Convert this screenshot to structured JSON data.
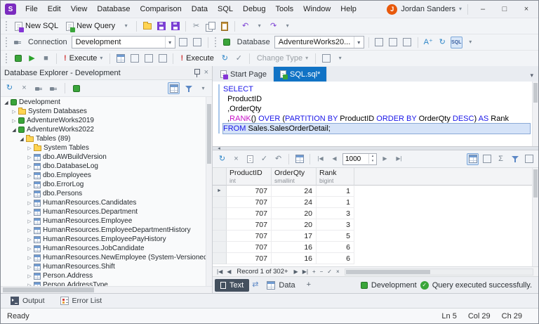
{
  "titlebar": {
    "app_initial": "S",
    "menus": [
      "File",
      "Edit",
      "View",
      "Database",
      "Comparison",
      "Data",
      "SQL",
      "Debug",
      "Tools",
      "Window",
      "Help"
    ],
    "user_initial": "J",
    "user_name": "Jordan Sanders"
  },
  "toolbars": {
    "new_sql": "New SQL",
    "new_query": "New Query",
    "connection_label": "Connection",
    "connection_value": "Development",
    "database_label": "Database",
    "database_value": "AdventureWorks20...",
    "execute_primary": "Execute",
    "execute_secondary": "Execute",
    "change_type": "Change Type"
  },
  "explorer": {
    "title": "Database Explorer - Development",
    "tree": [
      {
        "level": 0,
        "icon": "server",
        "label": "Development",
        "expanded": true
      },
      {
        "level": 1,
        "icon": "folder",
        "label": "System Databases",
        "expanded": false
      },
      {
        "level": 1,
        "icon": "database",
        "label": "AdventureWorks2019",
        "expanded": false
      },
      {
        "level": 1,
        "icon": "database",
        "label": "AdventureWorks2022",
        "expanded": true
      },
      {
        "level": 2,
        "icon": "folder",
        "label": "Tables (89)",
        "expanded": true
      },
      {
        "level": 3,
        "icon": "folder",
        "label": "System Tables",
        "expanded": false
      },
      {
        "level": 3,
        "icon": "table",
        "label": "dbo.AWBuildVersion",
        "expanded": false
      },
      {
        "level": 3,
        "icon": "table",
        "label": "dbo.DatabaseLog",
        "expanded": false
      },
      {
        "level": 3,
        "icon": "table",
        "label": "dbo.Employees",
        "expanded": false
      },
      {
        "level": 3,
        "icon": "table",
        "label": "dbo.ErrorLog",
        "expanded": false
      },
      {
        "level": 3,
        "icon": "table",
        "label": "dbo.Persons",
        "expanded": false
      },
      {
        "level": 3,
        "icon": "table",
        "label": "HumanResources.Candidates",
        "expanded": false
      },
      {
        "level": 3,
        "icon": "table",
        "label": "HumanResources.Department",
        "expanded": false
      },
      {
        "level": 3,
        "icon": "table",
        "label": "HumanResources.Employee",
        "expanded": false
      },
      {
        "level": 3,
        "icon": "table",
        "label": "HumanResources.EmployeeDepartmentHistory",
        "expanded": false
      },
      {
        "level": 3,
        "icon": "table",
        "label": "HumanResources.EmployeePayHistory",
        "expanded": false
      },
      {
        "level": 3,
        "icon": "table",
        "label": "HumanResources.JobCandidate",
        "expanded": false
      },
      {
        "level": 3,
        "icon": "table",
        "label": "HumanResources.NewEmployee (System-Versioned)",
        "expanded": false
      },
      {
        "level": 3,
        "icon": "table",
        "label": "HumanResources.Shift",
        "expanded": false
      },
      {
        "level": 3,
        "icon": "table",
        "label": "Person.Address",
        "expanded": false
      },
      {
        "level": 3,
        "icon": "table",
        "label": "Person.AddressType",
        "expanded": false
      }
    ]
  },
  "editor": {
    "tabs": [
      {
        "label": "Start Page"
      },
      {
        "label": "SQL.sql*"
      }
    ],
    "code": [
      {
        "tokens": [
          {
            "c": "kw",
            "t": "SELECT"
          }
        ]
      },
      {
        "tokens": [
          {
            "c": "pl",
            "t": "  ProductID"
          }
        ]
      },
      {
        "tokens": [
          {
            "c": "pl",
            "t": "  ,OrderQty"
          }
        ]
      },
      {
        "tokens": [
          {
            "c": "pl",
            "t": "  ,"
          },
          {
            "c": "fn",
            "t": "RANK"
          },
          {
            "c": "pl",
            "t": "() "
          },
          {
            "c": "kw",
            "t": "OVER"
          },
          {
            "c": "pl",
            "t": " ("
          },
          {
            "c": "kw",
            "t": "PARTITION BY"
          },
          {
            "c": "pl",
            "t": " ProductID "
          },
          {
            "c": "kw",
            "t": "ORDER BY"
          },
          {
            "c": "pl",
            "t": " OrderQty "
          },
          {
            "c": "kw",
            "t": "DESC"
          },
          {
            "c": "pl",
            "t": ") "
          },
          {
            "c": "kw",
            "t": "AS"
          },
          {
            "c": "pl",
            "t": " Rank"
          }
        ]
      },
      {
        "current": true,
        "tokens": [
          {
            "c": "kw",
            "t": "FROM"
          },
          {
            "c": "pl",
            "t": " Sales.SalesOrderDetail;"
          }
        ]
      }
    ]
  },
  "results": {
    "page_size": "1000",
    "columns": [
      {
        "name": "ProductID",
        "type": "int"
      },
      {
        "name": "OrderQty",
        "type": "smallint"
      },
      {
        "name": "Rank",
        "type": "bigint"
      }
    ],
    "rows": [
      [
        "707",
        "24",
        "1"
      ],
      [
        "707",
        "24",
        "1"
      ],
      [
        "707",
        "20",
        "3"
      ],
      [
        "707",
        "20",
        "3"
      ],
      [
        "707",
        "17",
        "5"
      ],
      [
        "707",
        "16",
        "6"
      ],
      [
        "707",
        "16",
        "6"
      ]
    ],
    "record_status": "Record 1 of 302+",
    "tab_text": "Text",
    "tab_data": "Data",
    "connection_name": "Development",
    "exec_status": "Query executed successfully."
  },
  "bottom_panel": {
    "tabs": [
      "Output",
      "Error List"
    ]
  },
  "statusbar": {
    "left": "Ready",
    "ln": "Ln 5",
    "col": "Col 29",
    "ch": "Ch 29"
  },
  "icons": {
    "dropdown": "▾",
    "overflow": "▾",
    "refresh": "↻",
    "play": "▶",
    "stop": "■",
    "undo": "↶",
    "redo": "↷",
    "cut": "✂",
    "close": "×",
    "minimize": "–",
    "maximize": "□",
    "check": "✓",
    "swap": "⇄",
    "first": "|◀",
    "prev": "◀",
    "next": "▶",
    "last": "▶|",
    "plus": "+",
    "minus": "−",
    "exclaim": "!",
    "row_arrow": "►",
    "spin_up": "▴",
    "spin_down": "▾",
    "sql": "SQL",
    "font_size": "A⁺",
    "sigma": "Σ",
    "back": "◂"
  }
}
